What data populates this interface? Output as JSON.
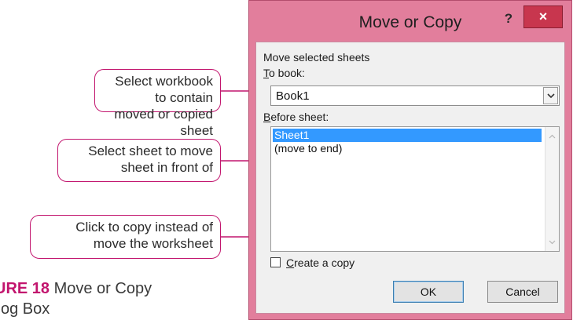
{
  "callouts": {
    "workbook": {
      "line1": "Select workbook to contain",
      "line2": "moved or copied sheet"
    },
    "sheet": {
      "line1": "Select sheet to move",
      "line2": "sheet in front of"
    },
    "copy": {
      "line1": "Click to copy instead of",
      "line2": "move the worksheet"
    }
  },
  "caption": {
    "label": "URE 18",
    "line1": " Move or Copy",
    "line2": "og Box"
  },
  "dialog": {
    "title": "Move or Copy",
    "help_label": "?",
    "close_label": "×",
    "move_selected_label": "Move selected sheets",
    "to_book_label": "To book:",
    "to_book_value": "Book1",
    "before_sheet_label": "Before sheet:",
    "sheets": [
      {
        "label": "Sheet1",
        "selected": true
      },
      {
        "label": "(move to end)",
        "selected": false
      }
    ],
    "create_copy_label": "Create a copy",
    "create_copy_checked": false,
    "ok_label": "OK",
    "cancel_label": "Cancel"
  },
  "colors": {
    "accent": "#c2156e",
    "window_frame": "#e27e9c",
    "close_button": "#c8364e",
    "selection": "#3399ff"
  }
}
